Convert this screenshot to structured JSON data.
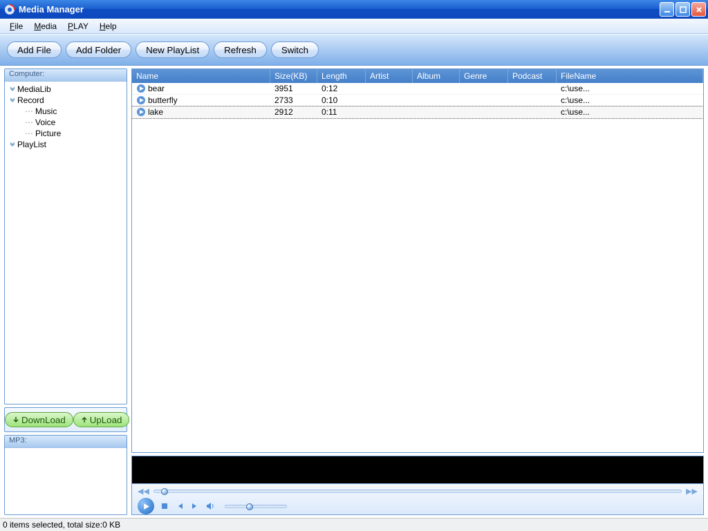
{
  "window": {
    "title": "Media Manager"
  },
  "menu": {
    "file": "File",
    "media": "Media",
    "play": "PLAY",
    "help": "Help"
  },
  "toolbar": {
    "add_file": "Add File",
    "add_folder": "Add Folder",
    "new_playlist": "New PlayList",
    "refresh": "Refresh",
    "switch": "Switch"
  },
  "sidebar": {
    "computer_label": "Computer:",
    "nodes": {
      "medialib": "MediaLib",
      "record": "Record",
      "music": "Music",
      "voice": "Voice",
      "picture": "Picture",
      "playlist": "PlayList"
    },
    "download": "DownLoad",
    "upload": "UpLoad",
    "mp3_label": "MP3:"
  },
  "grid": {
    "columns": {
      "name": "Name",
      "size": "Size(KB)",
      "length": "Length",
      "artist": "Artist",
      "album": "Album",
      "genre": "Genre",
      "podcast": "Podcast",
      "filename": "FileName"
    },
    "rows": [
      {
        "name": "bear",
        "size": "3951",
        "length": "0:12",
        "filename": "c:\\use..."
      },
      {
        "name": "butterfly",
        "size": "2733",
        "length": "0:10",
        "filename": "c:\\use..."
      },
      {
        "name": "lake",
        "size": "2912",
        "length": "0:11",
        "filename": "c:\\use..."
      }
    ],
    "selected_index": 2
  },
  "status": "0 items selected, total size:0 KB"
}
